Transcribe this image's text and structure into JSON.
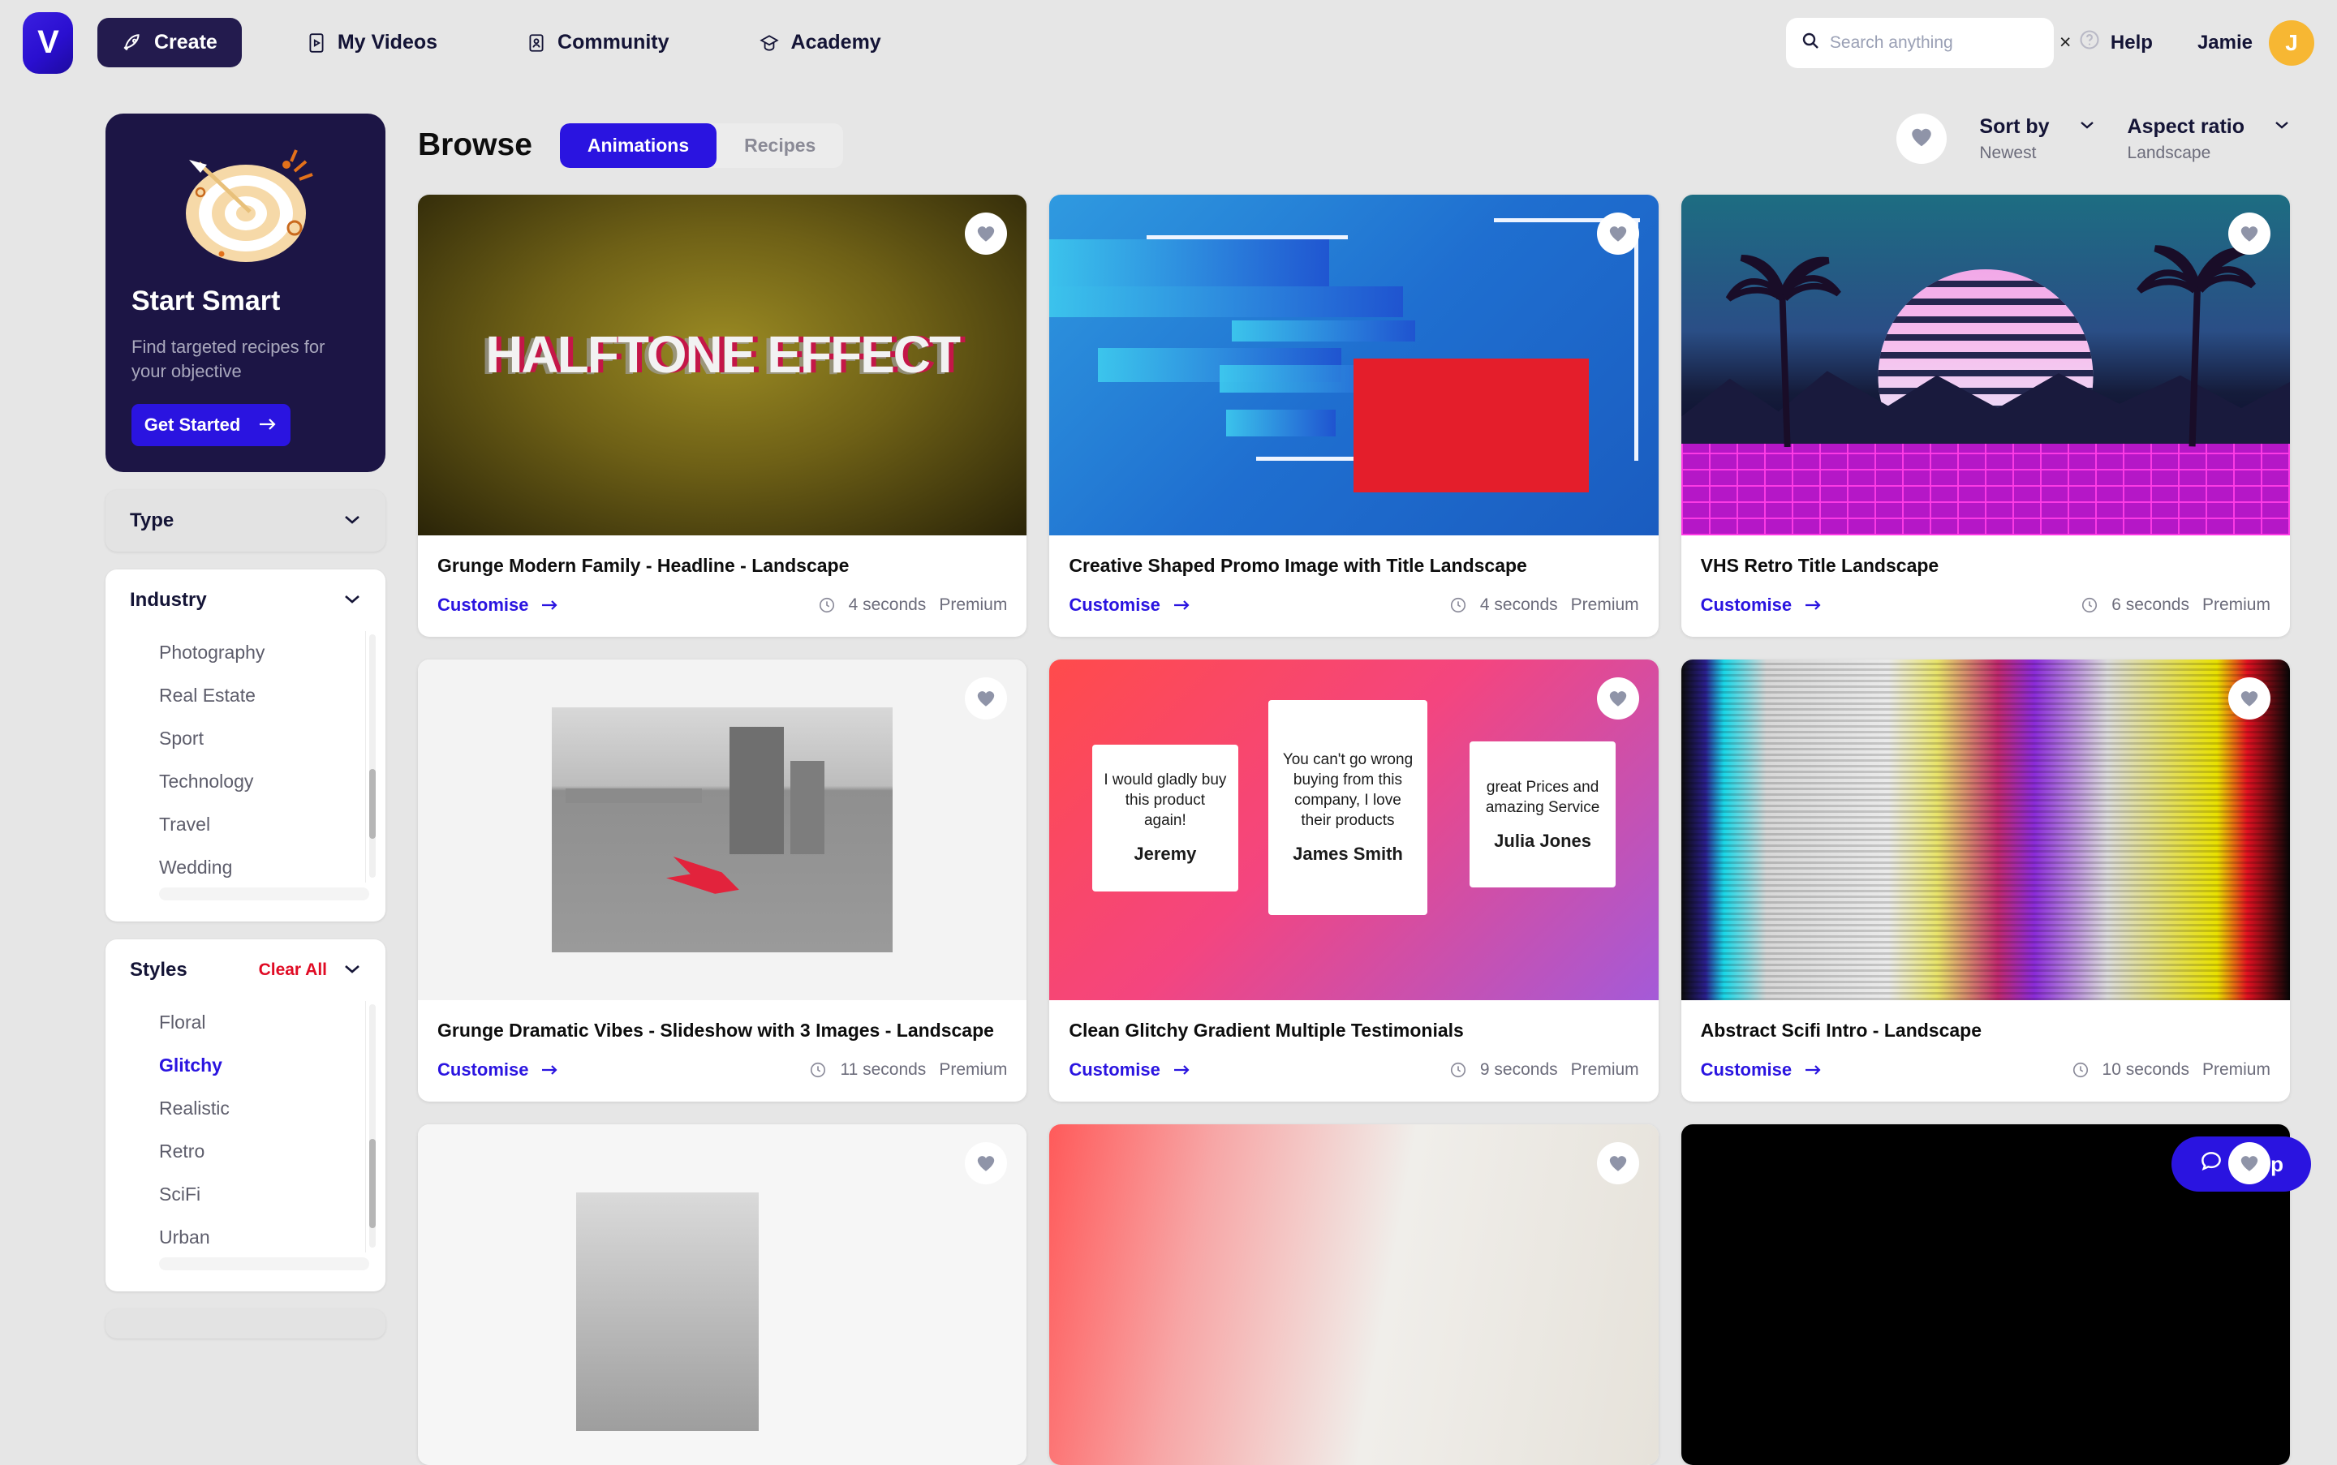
{
  "brand": {
    "logo_letter": "V",
    "accent": "#2a14e0",
    "dark": "#1c1545"
  },
  "topnav": {
    "items": [
      {
        "label": "Create",
        "icon": "rocket-icon",
        "active": true
      },
      {
        "label": "My Videos",
        "icon": "video-phone-icon",
        "active": false
      },
      {
        "label": "Community",
        "icon": "person-card-icon",
        "active": false
      },
      {
        "label": "Academy",
        "icon": "graduation-cap-icon",
        "active": false
      }
    ],
    "search": {
      "placeholder": "Search anything",
      "value": "",
      "clear_label": "×"
    },
    "help_label": "Help",
    "user_name": "Jamie",
    "avatar_initial": "J"
  },
  "promo": {
    "title": "Start Smart",
    "subtitle": "Find targeted recipes for your objective",
    "button_label": "Get Started",
    "illustration": "target-with-arrow"
  },
  "filters": [
    {
      "name": "Type",
      "collapsed": true,
      "clear_all": null,
      "items": []
    },
    {
      "name": "Industry",
      "collapsed": false,
      "clear_all": null,
      "items": [
        {
          "label": "Photography",
          "selected": false
        },
        {
          "label": "Real Estate",
          "selected": false
        },
        {
          "label": "Sport",
          "selected": false
        },
        {
          "label": "Technology",
          "selected": false
        },
        {
          "label": "Travel",
          "selected": false
        },
        {
          "label": "Wedding",
          "selected": false
        }
      ]
    },
    {
      "name": "Styles",
      "collapsed": false,
      "clear_all": "Clear All",
      "items": [
        {
          "label": "Floral",
          "selected": false
        },
        {
          "label": "Glitchy",
          "selected": true
        },
        {
          "label": "Realistic",
          "selected": false
        },
        {
          "label": "Retro",
          "selected": false
        },
        {
          "label": "SciFi",
          "selected": false
        },
        {
          "label": "Urban",
          "selected": false
        }
      ]
    }
  ],
  "browse": {
    "title": "Browse",
    "tabs": [
      {
        "label": "Animations",
        "active": true
      },
      {
        "label": "Recipes",
        "active": false
      }
    ],
    "favourites_icon": "heart-icon",
    "sort": {
      "label": "Sort by",
      "value": "Newest"
    },
    "aspect": {
      "label": "Aspect ratio",
      "value": "Landscape"
    }
  },
  "cards": [
    {
      "title": "Grunge Modern Family - Headline - Landscape",
      "customise": "Customise",
      "duration": "4 seconds",
      "tier": "Premium",
      "thumb": "halftone-effect",
      "thumb_text": "HALFTONE EFFECT"
    },
    {
      "title": "Creative Shaped Promo Image with Title Landscape",
      "customise": "Customise",
      "duration": "4 seconds",
      "tier": "Premium",
      "thumb": "blue-promo-shapes"
    },
    {
      "title": "VHS Retro Title Landscape",
      "customise": "Customise",
      "duration": "6 seconds",
      "tier": "Premium",
      "thumb": "synthwave-sunset"
    },
    {
      "title": "Grunge Dramatic Vibes - Slideshow with 3 Images - Landscape",
      "customise": "Customise",
      "duration": "11 seconds",
      "tier": "Premium",
      "thumb": "greyscale-city-arrow"
    },
    {
      "title": "Clean Glitchy Gradient Multiple Testimonials",
      "customise": "Customise",
      "duration": "9 seconds",
      "tier": "Premium",
      "thumb": "gradient-testimonials",
      "testimonials": [
        {
          "quote": "I would gladly buy this product again!",
          "name": "Jeremy"
        },
        {
          "quote": "You can't go wrong buying from this company, I love their products",
          "name": "James Smith"
        },
        {
          "quote": "great Prices and amazing Service",
          "name": "Julia Jones"
        }
      ]
    },
    {
      "title": "Abstract Scifi Intro - Landscape",
      "customise": "Customise",
      "duration": "10 seconds",
      "tier": "Premium",
      "thumb": "rgb-glitch"
    },
    {
      "thumb": "white-slideshow",
      "partial": true
    },
    {
      "thumb": "pink-office",
      "partial": true
    },
    {
      "thumb": "black",
      "partial": true
    }
  ],
  "help_widget": {
    "label": "Help",
    "icon": "chat-bubble-icon"
  }
}
